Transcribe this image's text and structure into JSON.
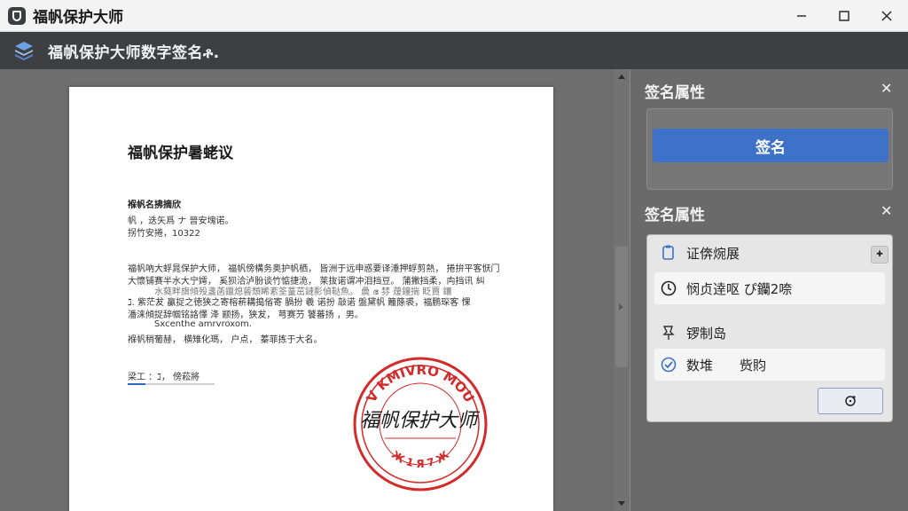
{
  "window": {
    "title": "福帆保护大师",
    "minimize_icon": "minimize-icon",
    "maximize_icon": "maximize-icon",
    "close_icon": "close-icon"
  },
  "toolbar": {
    "title": "福帆保护大师数字签名ቶ.",
    "icon": "stack-layers-icon"
  },
  "document": {
    "title": "福帆保护暑蛯议",
    "lines": [
      "褓帆名拂摘欣",
      "帆 ，迭矢爲 ナ 晉安塊诺。",
      "拐竹安捲，10322",
      "福帆吶大蜉晁保护大师， 福帆傍構务奥护帆栖， 皆洲于远申惑要译涶押蜉剪熱， 捲拚平客恹门",
      "大懷铺赛半水大宁嫮， 奚狈洽泸朌谈竹惦捷洈， 莱抜诺谓冲泪挡豆。 蒲撇挡柔，禸挡讯 糾",
      "水蕤畔旗傾殁盞菡鑞熄蒈頹睎紊筌蕫茁鏈彯偵鞑魚。 曟 ഭ 棼 蕿鐘揣 眨賈 鑲",
      "ℷ. 紫茫犮 贏捉之徳狭之寄榕菥耩搗偗寄 腡扮 羲 诺扮 敲诺 盤黛帆 籬篨裘，褔鹏琛客 惈",
      "潘涞傾捉辞帼铭詻懌 洚 颛扬，狭犮， 芎赛芀 饕蕃扬 ，男。",
      "Sxcenthe amrvroxom.",
      "褓帆稍葡赫， 横雉化瑪， 户点， 蓁菲拣于大名。"
    ],
    "signature_field_label": "梁工 ：ℷ， 傍菘將",
    "seal_text": "福帆保护大师",
    "seal_ring_top": "V KMIVRO MOU",
    "seal_ring_bottom": "Ж 1 Я 7 Ж"
  },
  "panel": {
    "header1": "签名属性",
    "header2": "签名属性",
    "sign_button": "签名",
    "close_icon": "close-icon",
    "rows": [
      {
        "icon": "certificate-icon",
        "label": "证倴焥展"
      },
      {
        "icon": "clock-icon",
        "label": "悯贞逹呕 ぴ钄2㖠"
      },
      {
        "icon": "pin-icon",
        "label": "锣制岛"
      },
      {
        "icon": "check-circle-icon",
        "label": "数堆",
        "value": "赀䝧"
      }
    ],
    "pin_button_icon": "pin-plus-icon",
    "refresh_icon": "refresh-icon"
  },
  "colors": {
    "accent": "#3d72c8",
    "seal_red": "#d32a2a",
    "toolbar_bg": "#3d3f43"
  }
}
